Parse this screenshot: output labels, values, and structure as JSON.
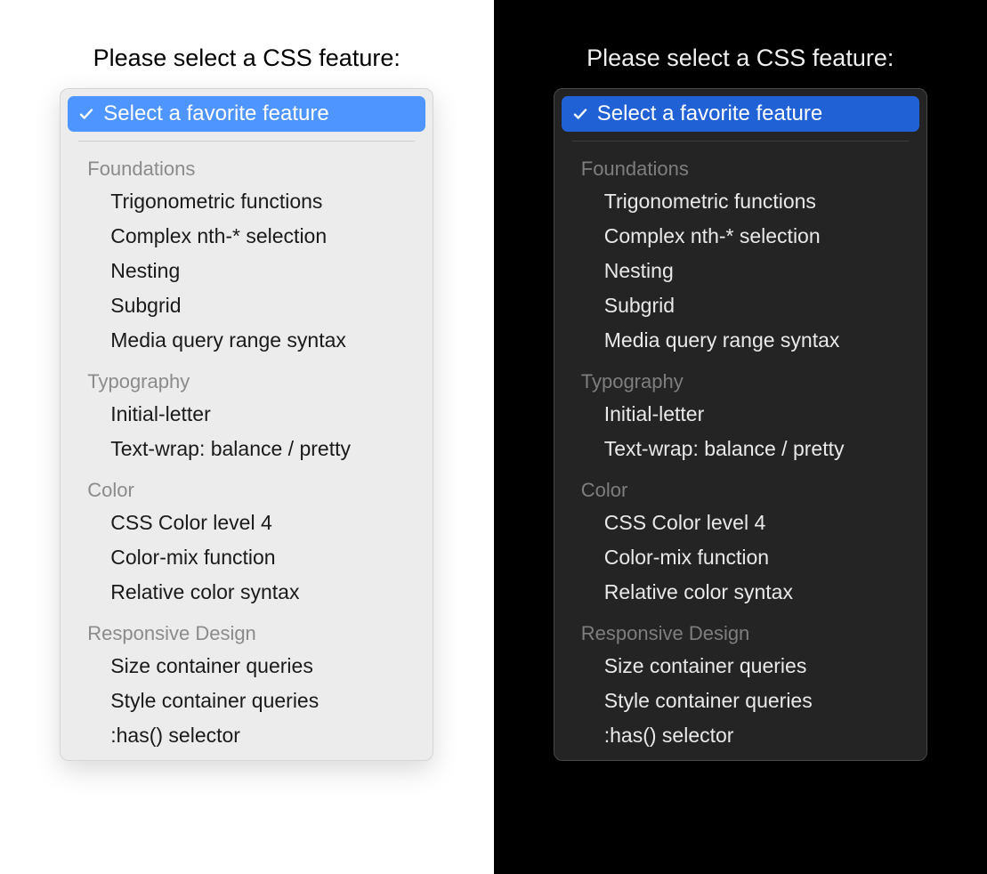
{
  "prompt": "Please select a CSS feature:",
  "colors": {
    "light_highlight": "#4f95ff",
    "dark_highlight": "#2161d6",
    "light_bg": "#ffffff",
    "dark_bg": "#000000",
    "light_panel": "#ececec",
    "dark_panel": "#242424"
  },
  "selected": {
    "label": "Select a favorite feature",
    "icon": "check-icon"
  },
  "groups": [
    {
      "label": "Foundations",
      "options": [
        "Trigonometric functions",
        "Complex nth-* selection",
        "Nesting",
        "Subgrid",
        "Media query range syntax"
      ]
    },
    {
      "label": "Typography",
      "options": [
        "Initial-letter",
        "Text-wrap: balance / pretty"
      ]
    },
    {
      "label": "Color",
      "options": [
        "CSS Color level 4",
        "Color-mix function",
        "Relative color syntax"
      ]
    },
    {
      "label": "Responsive Design",
      "options": [
        "Size container queries",
        "Style container queries",
        ":has() selector"
      ]
    }
  ]
}
